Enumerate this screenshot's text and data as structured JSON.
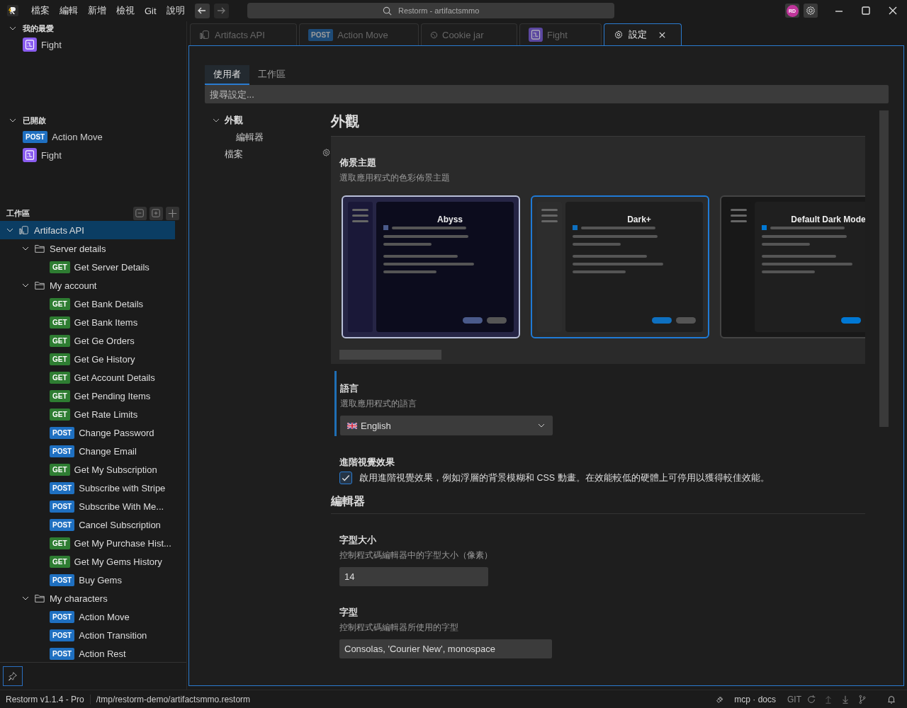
{
  "menu": [
    "檔案",
    "編輯",
    "新增",
    "檢視",
    "Git",
    "說明"
  ],
  "window": {
    "title": "Restorm - artifactsmmo",
    "avatar": "RD"
  },
  "favorites": {
    "title": "我的最愛",
    "expanded": true,
    "items": [
      {
        "kind": "flow",
        "label": "Fight"
      }
    ]
  },
  "opened": {
    "title": "已開啟",
    "expanded": true,
    "items": [
      {
        "kind": "request",
        "method": "POST",
        "label": "Action Move"
      },
      {
        "kind": "flow",
        "label": "Fight"
      }
    ]
  },
  "workspace": {
    "title": "工作區",
    "tree": [
      {
        "kind": "collection",
        "label": "Artifacts API",
        "selected": true,
        "expanded": true,
        "children": [
          {
            "kind": "folder",
            "label": "Server details",
            "selected": false,
            "expanded": true,
            "children": [
              {
                "kind": "request",
                "method": "GET",
                "label": "Get Server Details",
                "selected": false
              }
            ]
          },
          {
            "kind": "folder",
            "label": "My account",
            "selected": false,
            "expanded": true,
            "children": [
              {
                "kind": "request",
                "method": "GET",
                "label": "Get Bank Details",
                "selected": false
              },
              {
                "kind": "request",
                "method": "GET",
                "label": "Get Bank Items",
                "selected": false
              },
              {
                "kind": "request",
                "method": "GET",
                "label": "Get Ge Orders",
                "selected": false
              },
              {
                "kind": "request",
                "method": "GET",
                "label": "Get Ge History",
                "selected": false
              },
              {
                "kind": "request",
                "method": "GET",
                "label": "Get Account Details",
                "selected": false
              },
              {
                "kind": "request",
                "method": "GET",
                "label": "Get Pending Items",
                "selected": false
              },
              {
                "kind": "request",
                "method": "GET",
                "label": "Get Rate Limits",
                "selected": false
              },
              {
                "kind": "request",
                "method": "POST",
                "label": "Change Password",
                "selected": false
              },
              {
                "kind": "request",
                "method": "POST",
                "label": "Change Email",
                "selected": false
              },
              {
                "kind": "request",
                "method": "GET",
                "label": "Get My Subscription",
                "selected": false
              },
              {
                "kind": "request",
                "method": "POST",
                "label": "Subscribe with Stripe",
                "selected": false
              },
              {
                "kind": "request",
                "method": "POST",
                "label": "Subscribe With Me...",
                "selected": false
              },
              {
                "kind": "request",
                "method": "POST",
                "label": "Cancel Subscription",
                "selected": false
              },
              {
                "kind": "request",
                "method": "GET",
                "label": "Get My Purchase Hist...",
                "selected": false
              },
              {
                "kind": "request",
                "method": "GET",
                "label": "Get My Gems History",
                "selected": false
              },
              {
                "kind": "request",
                "method": "POST",
                "label": "Buy Gems",
                "selected": false
              }
            ]
          },
          {
            "kind": "folder",
            "label": "My characters",
            "selected": false,
            "expanded": true,
            "children": [
              {
                "kind": "request",
                "method": "POST",
                "label": "Action Move",
                "selected": false
              },
              {
                "kind": "request",
                "method": "POST",
                "label": "Action Transition",
                "selected": false
              },
              {
                "kind": "request",
                "method": "POST",
                "label": "Action Rest",
                "selected": false
              }
            ]
          }
        ]
      }
    ]
  },
  "tabs": [
    {
      "kind": "collection",
      "label": "Artifacts API",
      "selected": false
    },
    {
      "kind": "request",
      "method": "POST",
      "label": "Action Move",
      "selected": false
    },
    {
      "kind": "cookie",
      "label": "Cookie jar",
      "selected": false
    },
    {
      "kind": "flow",
      "label": "Fight",
      "selected": false
    },
    {
      "kind": "settings",
      "label": "設定",
      "selected": true
    }
  ],
  "settings": {
    "scope_tabs": [
      {
        "label": "使用者",
        "selected": true
      },
      {
        "label": "工作區",
        "selected": false
      }
    ],
    "search": {
      "placeholder": "搜尋設定..."
    },
    "nav": [
      {
        "label": "外觀",
        "expanded": true,
        "children": [
          {
            "label": "編輯器"
          }
        ]
      },
      {
        "label": "檔案"
      }
    ],
    "appearance": {
      "heading": "外觀",
      "theme": {
        "label": "佈景主題",
        "description": "選取應用程式的色彩佈景主題",
        "themes": [
          {
            "name": "Abyss",
            "selected": false,
            "hovered": true,
            "color": "#262545"
          },
          {
            "name": "Dark+",
            "selected": true,
            "hovered": false,
            "color": "#2b2b2b"
          },
          {
            "name": "Default Dark Mode",
            "selected": false,
            "hovered": false,
            "color": "#181818"
          }
        ]
      },
      "language": {
        "label": "語言",
        "description": "選取應用程式的語言",
        "value": "English"
      },
      "effects": {
        "label": "進階視覺效果",
        "description": "啟用進階視覺效果，例如浮層的背景模糊和 CSS 動畫。在效能較低的硬體上可停用以獲得較佳效能。",
        "checked": true
      }
    },
    "editor": {
      "heading": "編輯器",
      "font_size": {
        "label": "字型大小",
        "description": "控制程式碼編輯器中的字型大小（像素）",
        "value": "14"
      },
      "font_family": {
        "label": "字型",
        "description": "控制程式碼編輯器所使用的字型",
        "value": "Consolas, 'Courier New', monospace"
      }
    }
  },
  "status_bar": {
    "app": "Restorm v1.1.4 - Pro",
    "path": "/tmp/restorm-demo/artifactsmmo.restorm",
    "mcp": "mcp · docs",
    "git": "GIT"
  }
}
